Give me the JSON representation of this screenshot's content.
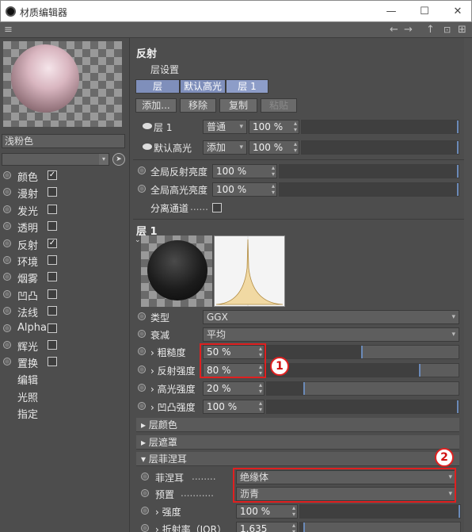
{
  "window": {
    "title": "材质编辑器",
    "controls": [
      "—",
      "☐",
      "✕"
    ]
  },
  "menubar": {
    "menu_icon": "hamburger-icon",
    "nav_icons": [
      "←",
      "→",
      "↑",
      "🔒",
      "⊞"
    ]
  },
  "material": {
    "name": "浅粉色",
    "preview_colors": {
      "ball": "#d9b6c0"
    }
  },
  "channels": [
    {
      "label": "颜色",
      "checked": true,
      "check": "✓"
    },
    {
      "label": "漫射",
      "checked": false,
      "check": ""
    },
    {
      "label": "发光",
      "checked": false,
      "check": ""
    },
    {
      "label": "透明",
      "checked": false,
      "check": ""
    },
    {
      "label": "反射",
      "checked": true,
      "check": "✓"
    },
    {
      "label": "环境",
      "checked": false,
      "check": ""
    },
    {
      "label": "烟雾",
      "checked": false,
      "check": ""
    },
    {
      "label": "凹凸",
      "checked": false,
      "check": ""
    },
    {
      "label": "法线",
      "checked": false,
      "check": ""
    },
    {
      "label": "Alpha",
      "checked": false,
      "check": ""
    },
    {
      "label": "辉光",
      "checked": false,
      "check": ""
    },
    {
      "label": "置换",
      "checked": false,
      "check": ""
    }
  ],
  "extras": [
    "编辑",
    "光照",
    "指定"
  ],
  "reflect": {
    "title": "反射",
    "layer_settings": "层设置",
    "tabs": [
      "层",
      "默认高光",
      "层 1"
    ],
    "buttons": [
      "添加...",
      "移除",
      "复制",
      "粘贴"
    ],
    "layers": [
      {
        "name": "层 1",
        "mode": "普通",
        "value": "100 %",
        "fill": 1.0
      },
      {
        "name": "默认高光",
        "mode": "添加",
        "value": "100 %",
        "fill": 1.0
      }
    ],
    "global_reflect": {
      "label": "全局反射亮度",
      "value": "100 %",
      "fill": 1.0
    },
    "global_spec": {
      "label": "全局高光亮度",
      "value": "100 %",
      "fill": 1.0
    },
    "separate": {
      "label": "分离通道",
      "dots": "......"
    }
  },
  "layer1": {
    "title": "层 1",
    "type": {
      "label": "类型",
      "value": "GGX"
    },
    "atten": {
      "label": "衰减",
      "value": "平均"
    },
    "roughness": {
      "label": "粗糙度",
      "value": "50 %",
      "fill": 0.5
    },
    "refl_strength": {
      "label": "反射强度",
      "value": "80 %",
      "fill": 0.8
    },
    "spec_strength": {
      "label": "高光强度",
      "value": "20 %",
      "fill": 0.2
    },
    "bump_strength": {
      "label": "凹凸强度",
      "value": "100 %",
      "fill": 1.0
    },
    "groups": [
      "层颜色",
      "层遮罩",
      "层菲涅耳"
    ],
    "fresnel": {
      "label": "菲涅耳",
      "value": "绝缘体",
      "dots": "........"
    },
    "preset": {
      "label": "预置",
      "value": "沥青",
      "dots": "..........."
    },
    "strength": {
      "label": "强度",
      "value": "100 %",
      "fill": 1.0
    },
    "ior": {
      "label": "折射率（IOR）",
      "value": "1.635",
      "fill": 0.03
    }
  },
  "callouts": [
    "1",
    "2"
  ]
}
